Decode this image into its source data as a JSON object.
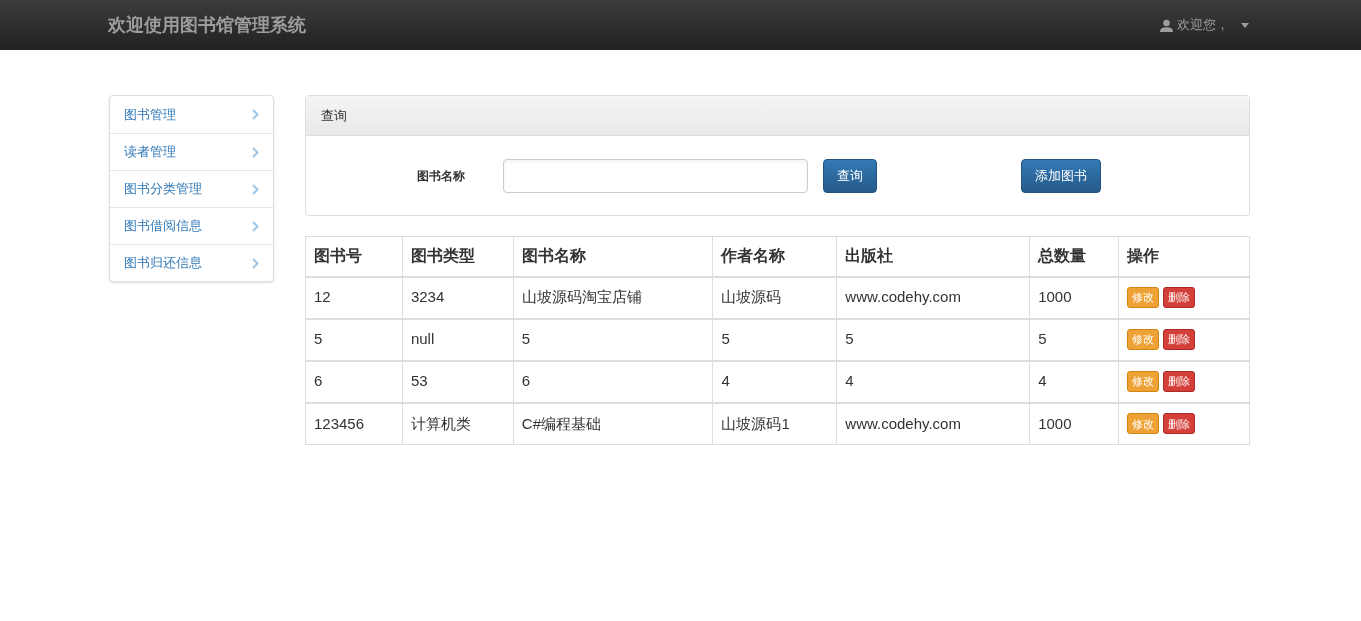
{
  "navbar": {
    "title": "欢迎使用图书馆管理系统",
    "user_menu": "欢迎您，"
  },
  "sidebar": {
    "items": [
      {
        "label": "图书管理"
      },
      {
        "label": "读者管理"
      },
      {
        "label": "图书分类管理"
      },
      {
        "label": "图书借阅信息"
      },
      {
        "label": "图书归还信息"
      }
    ]
  },
  "query_panel": {
    "heading": "查询",
    "field_label": "图书名称",
    "search_button": "查询",
    "add_button": "添加图书"
  },
  "table": {
    "columns": [
      "图书号",
      "图书类型",
      "图书名称",
      "作者名称",
      "出版社",
      "总数量",
      "操作"
    ],
    "rows": [
      {
        "cells": [
          "12",
          "3234",
          "山坡源码淘宝店铺",
          "山坡源码",
          "www.codehy.com",
          "1000"
        ],
        "actions": [
          {
            "kind": "edit",
            "label": "修改"
          },
          {
            "kind": "delete",
            "label": "删除"
          }
        ]
      },
      {
        "cells": [
          "5",
          "null",
          "5",
          "5",
          "5",
          "5"
        ],
        "actions": [
          {
            "kind": "edit",
            "label": "修改"
          },
          {
            "kind": "delete",
            "label": "删除"
          }
        ]
      },
      {
        "cells": [
          "6",
          "53",
          "6",
          "4",
          "4",
          "4"
        ],
        "actions": [
          {
            "kind": "edit",
            "label": "修改"
          },
          {
            "kind": "delete",
            "label": "删除"
          }
        ]
      },
      {
        "cells": [
          "123456",
          "计算机类",
          "C#编程基础",
          "山坡源码1",
          "www.codehy.com",
          "1000"
        ],
        "actions": [
          {
            "kind": "edit",
            "label": "修改"
          },
          {
            "kind": "delete",
            "label": "删除"
          }
        ]
      }
    ]
  }
}
